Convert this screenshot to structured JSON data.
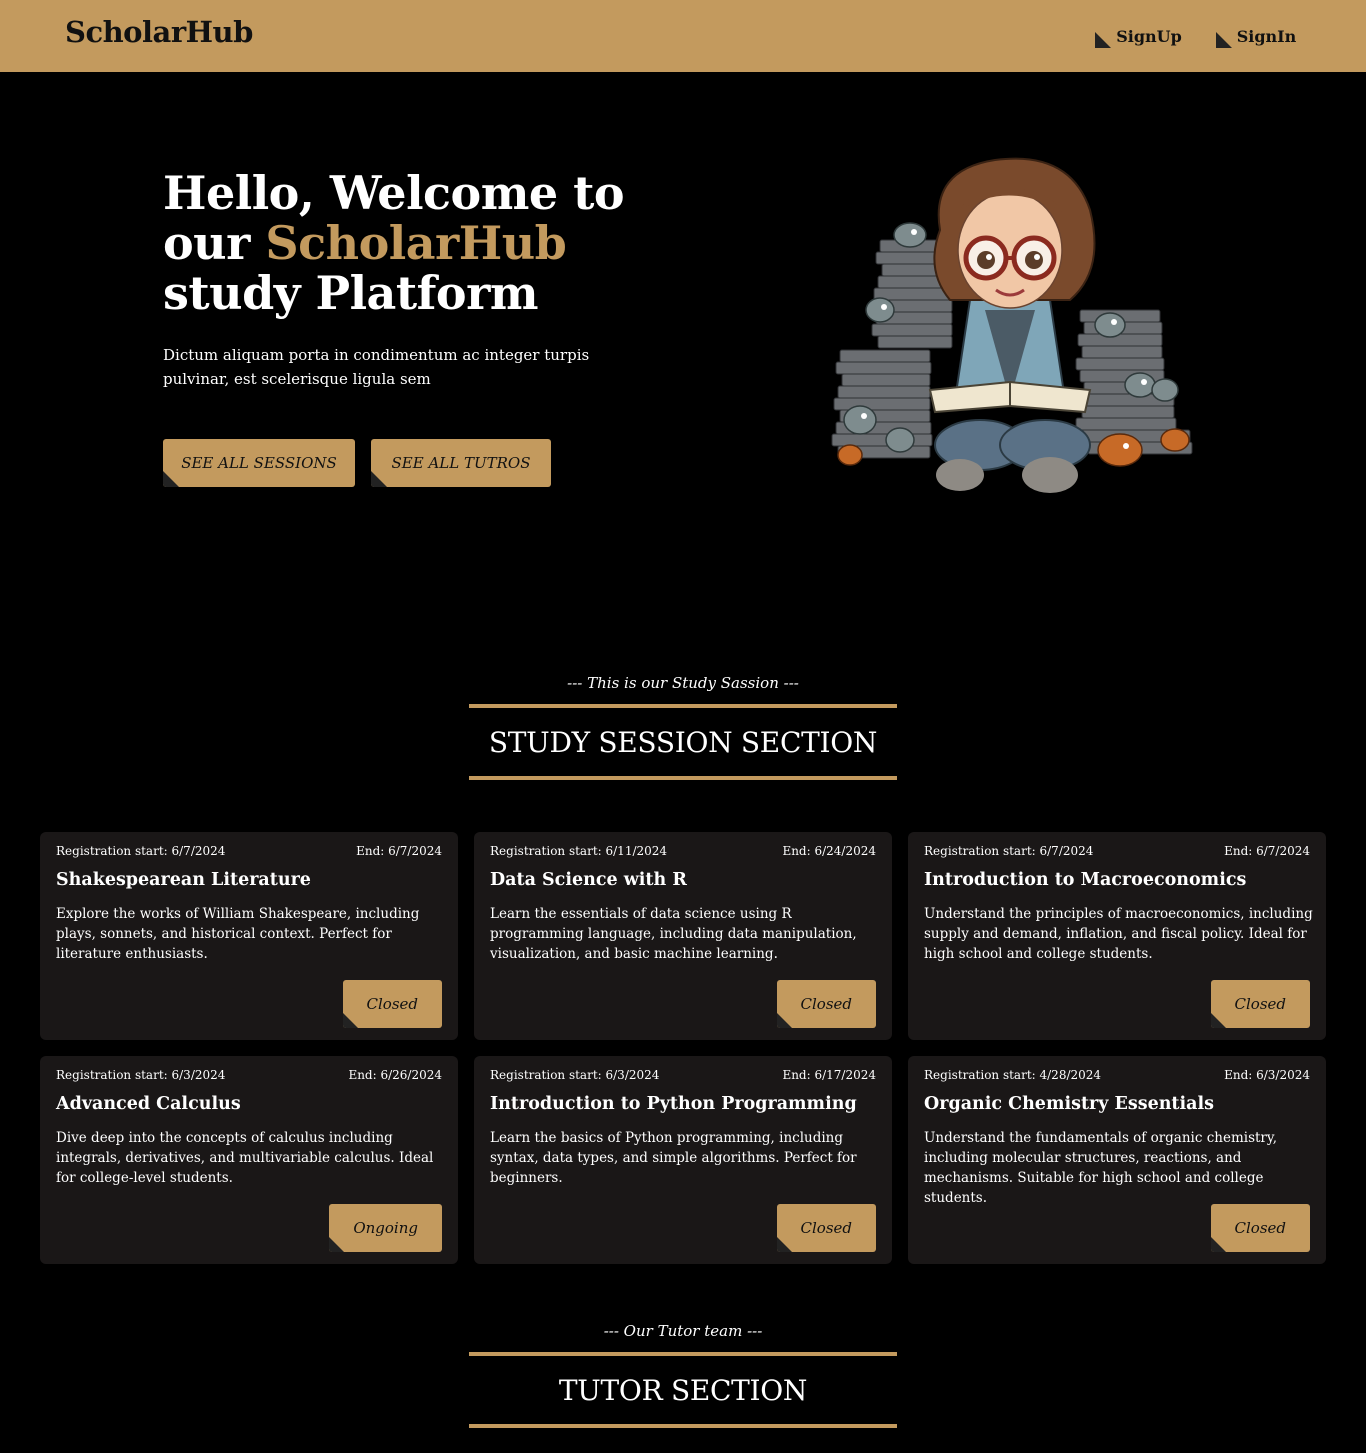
{
  "nav": {
    "brand": "ScholarHub",
    "signup_label": "SignUp",
    "signin_label": "SignIn"
  },
  "hero": {
    "title_line1": "Hello, Welcome to",
    "title_our": "our",
    "title_brand": "ScholarHub",
    "title_line3": "study Platform",
    "description": "Dictum aliquam porta in condimentum ac integer turpis pulvinar, est scelerisque ligula sem",
    "btn_sessions": "SEE ALL SESSIONS",
    "btn_tutors": "SEE ALL TUTROS"
  },
  "sessions_section": {
    "subtitle": "--- This is our Study Sassion ---",
    "heading": "STUDY SESSION SECTION",
    "cards": [
      {
        "reg": "Registration start: 6/7/2024",
        "end": "End: 6/7/2024",
        "title": "Shakespearean Literature",
        "desc": "Explore the works of William Shakespeare, including plays, sonnets, and historical context. Perfect for literature enthusiasts.",
        "status": "Closed"
      },
      {
        "reg": "Registration start: 6/11/2024",
        "end": "End: 6/24/2024",
        "title": "Data Science with R",
        "desc": "Learn the essentials of data science using R programming language, including data manipulation, visualization, and basic machine learning.",
        "status": "Closed"
      },
      {
        "reg": "Registration start: 6/7/2024",
        "end": "End: 6/7/2024",
        "title": "Introduction to Macroeconomics",
        "desc": "Understand the principles of macroeconomics, including supply and demand, inflation, and fiscal policy. Ideal for high school and college students.",
        "status": "Closed"
      },
      {
        "reg": "Registration start: 6/3/2024",
        "end": "End: 6/26/2024",
        "title": "Advanced Calculus",
        "desc": "Dive deep into the concepts of calculus including integrals, derivatives, and multivariable calculus. Ideal for college-level students.",
        "status": "Ongoing"
      },
      {
        "reg": "Registration start: 6/3/2024",
        "end": "End: 6/17/2024",
        "title": "Introduction to Python Programming",
        "desc": "Learn the basics of Python programming, including syntax, data types, and simple algorithms. Perfect for beginners.",
        "status": "Closed"
      },
      {
        "reg": "Registration start: 4/28/2024",
        "end": "End: 6/3/2024",
        "title": "Organic Chemistry Essentials",
        "desc": "Understand the fundamentals of organic chemistry, including molecular structures, reactions, and mechanisms. Suitable for high school and college students.",
        "status": "Closed"
      }
    ]
  },
  "tutor_section": {
    "subtitle": "--- Our Tutor team ---",
    "heading": "TUTOR SECTION"
  },
  "colors": {
    "accent": "#c39a5e",
    "background": "#000000",
    "card": "#1a1717"
  }
}
